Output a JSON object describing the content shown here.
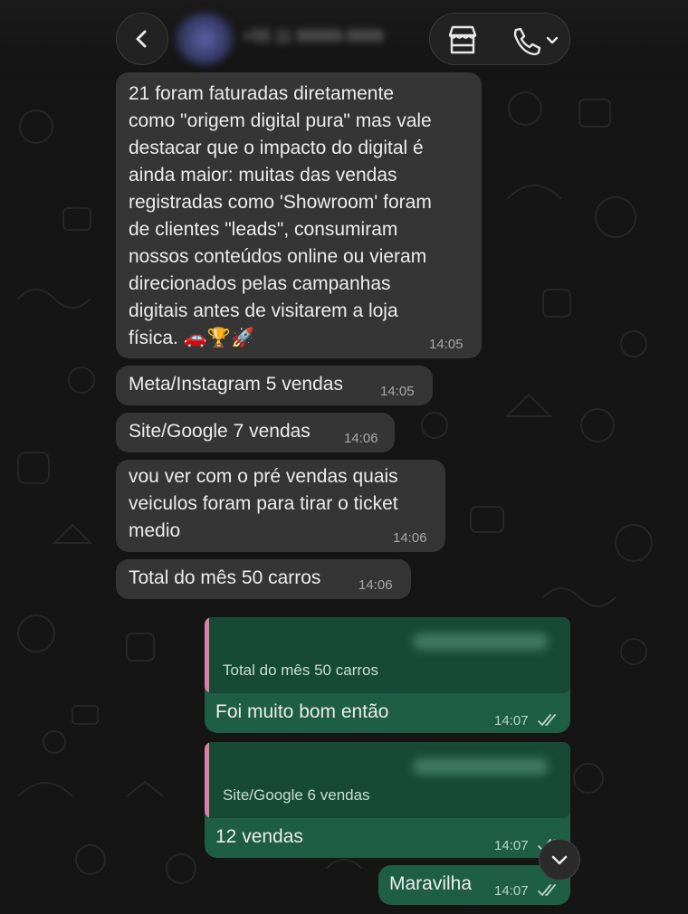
{
  "header": {
    "contact_name": "+55 11 99999-9999",
    "back_icon": "chevron-left-icon",
    "store_icon": "storefront-icon",
    "call_icon": "phone-icon"
  },
  "messages": [
    {
      "direction": "incoming",
      "lines": [
        "21 foram faturadas diretamente",
        "como \"origem digital pura\" mas vale",
        "destacar que o impacto do digital é",
        "ainda maior: muitas das vendas",
        "registradas como 'Showroom' foram",
        "de clientes \"leads\", consumiram",
        "nossos conteúdos online ou vieram",
        "direcionados pelas campanhas",
        "digitais antes de visitarem a loja",
        "física. 🚗🏆🚀"
      ],
      "time": "14:05"
    },
    {
      "direction": "incoming",
      "text": "Meta/Instagram 5 vendas",
      "time": "14:05"
    },
    {
      "direction": "incoming",
      "text": "Site/Google 7 vendas",
      "time": "14:06"
    },
    {
      "direction": "incoming",
      "lines": [
        "vou ver com o pré vendas quais",
        "veiculos foram para tirar o ticket",
        "medio"
      ],
      "time": "14:06"
    },
    {
      "direction": "incoming",
      "text": "Total do mês 50 carros",
      "time": "14:06"
    },
    {
      "direction": "outgoing",
      "quoted": "Total do mês 50 carros",
      "text": "Foi muito bom então",
      "time": "14:07"
    },
    {
      "direction": "outgoing",
      "quoted": "Site/Google 6 vendas",
      "text": "12 vendas",
      "time": "14:07"
    },
    {
      "direction": "outgoing",
      "text": "Maravilha",
      "time": "14:07"
    }
  ],
  "colors": {
    "incoming_bubble": "#353535",
    "outgoing_bubble": "#1e5e45",
    "quote_bar": "#e07fa5"
  }
}
